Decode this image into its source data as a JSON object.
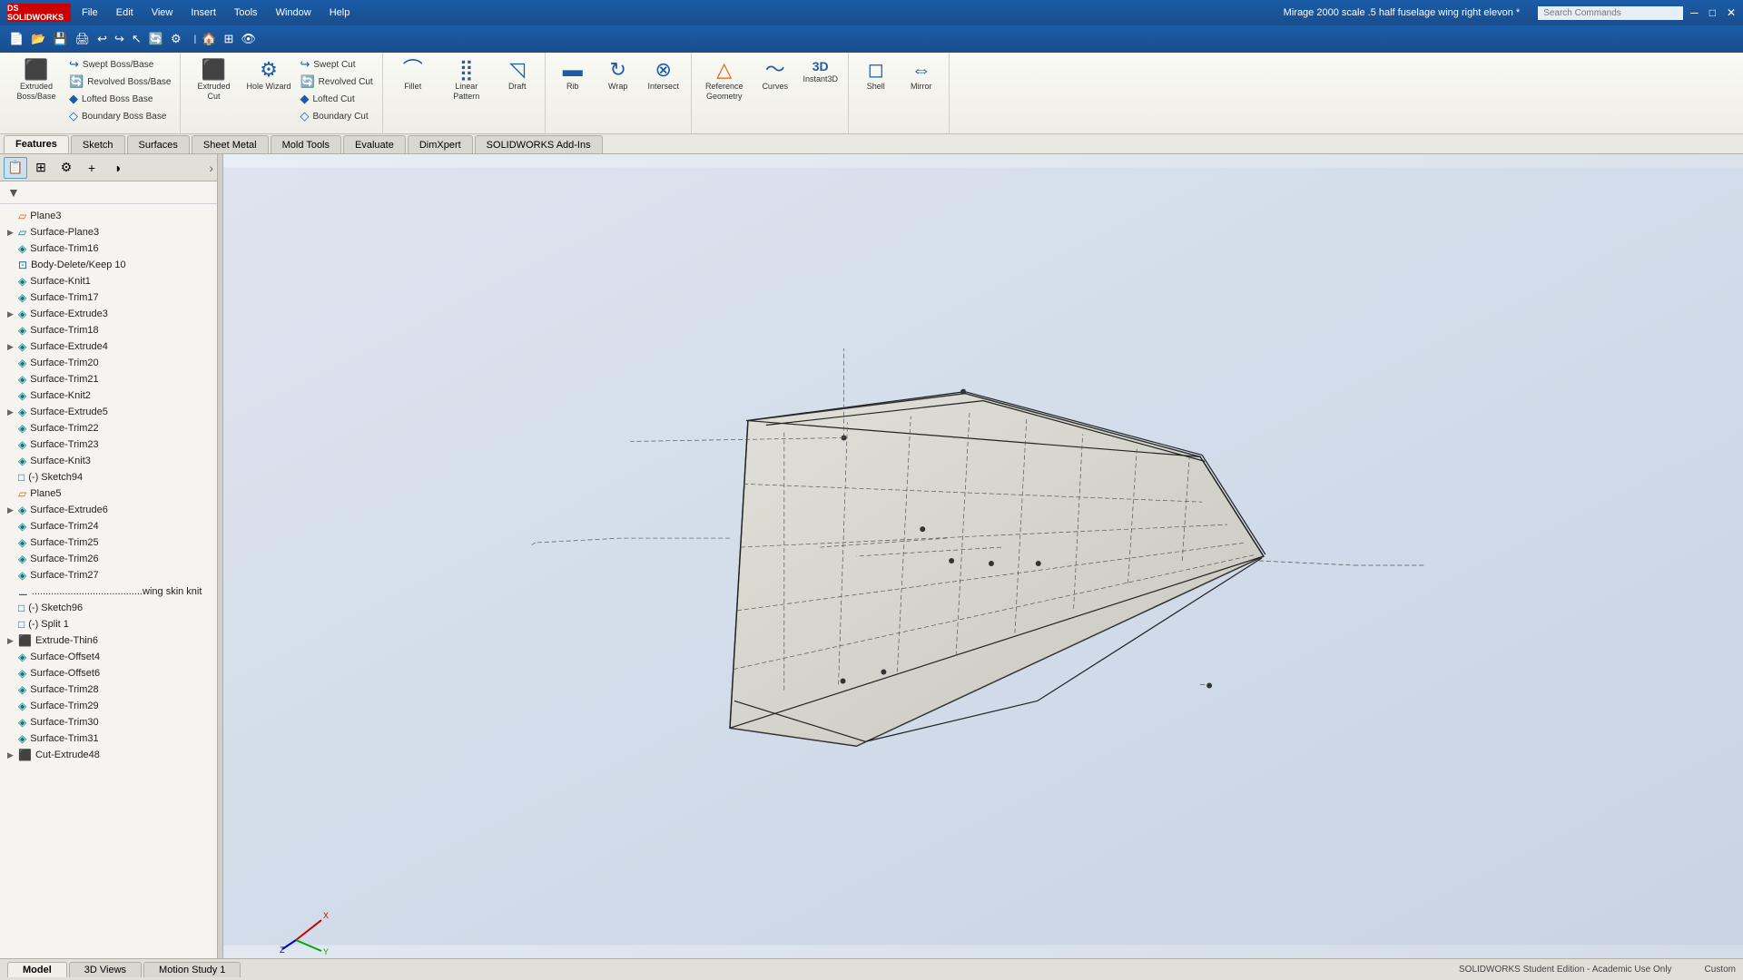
{
  "app": {
    "logo": "DS SOLIDWORKS",
    "name": "SOLIDWORKS",
    "doc_title": "Mirage 2000 scale .5 half fuselage wing right  elevon *"
  },
  "menu": {
    "items": [
      "File",
      "Edit",
      "View",
      "Insert",
      "Tools",
      "Window",
      "Help"
    ]
  },
  "search": {
    "placeholder": "Search Commands"
  },
  "ribbon": {
    "groups": [
      {
        "name": "boss-base-group",
        "items": [
          {
            "id": "extruded-boss",
            "label": "Extruded\nBoss/Base",
            "icon": "⬛"
          },
          {
            "id": "revolved-boss",
            "label": "Revolved\nBoss/Base",
            "icon": "🔄"
          },
          {
            "id": "lofted-boss",
            "label": "Lofted Boss\nBase",
            "icon": "◆"
          },
          {
            "id": "boundary-boss",
            "label": "Boundary Boss\nBase",
            "icon": "◇"
          }
        ],
        "subItems": [
          {
            "id": "swept-boss",
            "label": "Swept Boss/Base",
            "icon": "↪"
          }
        ]
      },
      {
        "name": "cut-group",
        "items": [
          {
            "id": "extruded-cut",
            "label": "Extruded\nCut",
            "icon": "⬛"
          },
          {
            "id": "hole-wizard",
            "label": "Hole\nWizard",
            "icon": "⚙"
          },
          {
            "id": "revolved-cut",
            "label": "Revolved\nCut",
            "icon": "🔄"
          }
        ],
        "subItems": [
          {
            "id": "swept-cut",
            "label": "Swept Cut",
            "icon": "↪"
          },
          {
            "id": "lofted-cut",
            "label": "Lofted Cut",
            "icon": "◆"
          },
          {
            "id": "boundary-cut",
            "label": "Boundary Cut",
            "icon": "◇"
          }
        ]
      },
      {
        "name": "features-group",
        "items": [
          {
            "id": "fillet",
            "label": "Fillet",
            "icon": "◜"
          },
          {
            "id": "linear-pattern",
            "label": "Linear\nPattern",
            "icon": "⣿"
          },
          {
            "id": "draft",
            "label": "Draft",
            "icon": "◹"
          }
        ]
      },
      {
        "name": "tools-group",
        "items": [
          {
            "id": "rib",
            "label": "Rib",
            "icon": "▬"
          },
          {
            "id": "wrap",
            "label": "Wrap",
            "icon": "↻"
          },
          {
            "id": "intersect",
            "label": "Intersect",
            "icon": "⊗"
          }
        ]
      },
      {
        "name": "reference-group",
        "items": [
          {
            "id": "reference-geometry",
            "label": "Reference\nGeometry",
            "icon": "△"
          },
          {
            "id": "curves",
            "label": "Curves",
            "icon": "〜"
          },
          {
            "id": "instant3d",
            "label": "Instant3D",
            "icon": "3D"
          }
        ]
      },
      {
        "name": "shell-mirror-group",
        "items": [
          {
            "id": "shell",
            "label": "Shell",
            "icon": "◻"
          },
          {
            "id": "mirror",
            "label": "Mirror",
            "icon": "⇔"
          }
        ]
      }
    ]
  },
  "tabs": {
    "feature_tabs": [
      "Features",
      "Sketch",
      "Surfaces",
      "Sheet Metal",
      "Mold Tools",
      "Evaluate",
      "DimXpert",
      "SOLIDWORKS Add-Ins"
    ],
    "active": "Features"
  },
  "panel": {
    "icons": [
      {
        "id": "feature-manager",
        "icon": "📋",
        "title": "FeatureManager"
      },
      {
        "id": "property-manager",
        "icon": "⊞",
        "title": "PropertyManager"
      },
      {
        "id": "configuration-manager",
        "icon": "⚙",
        "title": "ConfigurationManager"
      },
      {
        "id": "dim-xpert-manager",
        "icon": "+",
        "title": "DimXpertManager"
      },
      {
        "id": "display-manager",
        "icon": "◑",
        "title": "DisplayManager"
      }
    ],
    "expand-icon": "›"
  },
  "tree": {
    "items": [
      {
        "id": "plane3",
        "label": "Plane3",
        "icon": "▱",
        "indent": 0,
        "has_arrow": false,
        "icon_color": "orange"
      },
      {
        "id": "surface-plane3",
        "label": "Surface-Plane3",
        "icon": "▱",
        "indent": 0,
        "has_arrow": true,
        "icon_color": "teal"
      },
      {
        "id": "surface-trim16",
        "label": "Surface-Trim16",
        "icon": "◈",
        "indent": 0,
        "has_arrow": false,
        "icon_color": "teal"
      },
      {
        "id": "body-delete-keep10",
        "label": "Body-Delete/Keep 10",
        "icon": "⊡",
        "indent": 0,
        "has_arrow": false,
        "icon_color": "blue"
      },
      {
        "id": "surface-knit1",
        "label": "Surface-Knit1",
        "icon": "◈",
        "indent": 0,
        "has_arrow": false,
        "icon_color": "teal"
      },
      {
        "id": "surface-trim17",
        "label": "Surface-Trim17",
        "icon": "◈",
        "indent": 0,
        "has_arrow": false,
        "icon_color": "teal"
      },
      {
        "id": "surface-extrude3",
        "label": "Surface-Extrude3",
        "icon": "◈",
        "indent": 0,
        "has_arrow": true,
        "icon_color": "teal"
      },
      {
        "id": "surface-trim18",
        "label": "Surface-Trim18",
        "icon": "◈",
        "indent": 0,
        "has_arrow": false,
        "icon_color": "teal"
      },
      {
        "id": "surface-extrude4",
        "label": "Surface-Extrude4",
        "icon": "◈",
        "indent": 0,
        "has_arrow": true,
        "icon_color": "teal"
      },
      {
        "id": "surface-trim20",
        "label": "Surface-Trim20",
        "icon": "◈",
        "indent": 0,
        "has_arrow": false,
        "icon_color": "teal"
      },
      {
        "id": "surface-trim21",
        "label": "Surface-Trim21",
        "icon": "◈",
        "indent": 0,
        "has_arrow": false,
        "icon_color": "teal"
      },
      {
        "id": "surface-knit2",
        "label": "Surface-Knit2",
        "icon": "◈",
        "indent": 0,
        "has_arrow": false,
        "icon_color": "teal"
      },
      {
        "id": "surface-extrude5",
        "label": "Surface-Extrude5",
        "icon": "◈",
        "indent": 0,
        "has_arrow": true,
        "icon_color": "teal"
      },
      {
        "id": "surface-trim22",
        "label": "Surface-Trim22",
        "icon": "◈",
        "indent": 0,
        "has_arrow": false,
        "icon_color": "teal"
      },
      {
        "id": "surface-trim23",
        "label": "Surface-Trim23",
        "icon": "◈",
        "indent": 0,
        "has_arrow": false,
        "icon_color": "teal"
      },
      {
        "id": "surface-knit3",
        "label": "Surface-Knit3",
        "icon": "◈",
        "indent": 0,
        "has_arrow": false,
        "icon_color": "teal"
      },
      {
        "id": "sketch94",
        "label": "(-) Sketch94",
        "icon": "□",
        "indent": 0,
        "has_arrow": false,
        "icon_color": "blue"
      },
      {
        "id": "plane5",
        "label": "Plane5",
        "icon": "▱",
        "indent": 0,
        "has_arrow": false,
        "icon_color": "orange"
      },
      {
        "id": "surface-extrude6",
        "label": "Surface-Extrude6",
        "icon": "◈",
        "indent": 0,
        "has_arrow": true,
        "icon_color": "teal"
      },
      {
        "id": "surface-trim24",
        "label": "Surface-Trim24",
        "icon": "◈",
        "indent": 0,
        "has_arrow": false,
        "icon_color": "teal"
      },
      {
        "id": "surface-trim25",
        "label": "Surface-Trim25",
        "icon": "◈",
        "indent": 0,
        "has_arrow": false,
        "icon_color": "teal"
      },
      {
        "id": "surface-trim26",
        "label": "Surface-Trim26",
        "icon": "◈",
        "indent": 0,
        "has_arrow": false,
        "icon_color": "teal"
      },
      {
        "id": "surface-trim27",
        "label": "Surface-Trim27",
        "icon": "◈",
        "indent": 0,
        "has_arrow": false,
        "icon_color": "teal"
      },
      {
        "id": "wing-skin-knit",
        "label": "........................................wing skin knit",
        "icon": "⚊",
        "indent": 0,
        "has_arrow": false,
        "icon_color": "blue"
      },
      {
        "id": "sketch96",
        "label": "(-) Sketch96",
        "icon": "□",
        "indent": 0,
        "has_arrow": false,
        "icon_color": "blue"
      },
      {
        "id": "split1",
        "label": "(-) Split 1",
        "icon": "□",
        "indent": 0,
        "has_arrow": false,
        "icon_color": "blue"
      },
      {
        "id": "extrude-thin6",
        "label": "Extrude-Thin6",
        "icon": "⬛",
        "indent": 0,
        "has_arrow": true,
        "icon_color": "blue"
      },
      {
        "id": "surface-offset4",
        "label": "Surface-Offset4",
        "icon": "◈",
        "indent": 0,
        "has_arrow": false,
        "icon_color": "teal"
      },
      {
        "id": "surface-offset6",
        "label": "Surface-Offset6",
        "icon": "◈",
        "indent": 0,
        "has_arrow": false,
        "icon_color": "teal"
      },
      {
        "id": "surface-trim28",
        "label": "Surface-Trim28",
        "icon": "◈",
        "indent": 0,
        "has_arrow": false,
        "icon_color": "teal"
      },
      {
        "id": "surface-trim29",
        "label": "Surface-Trim29",
        "icon": "◈",
        "indent": 0,
        "has_arrow": false,
        "icon_color": "teal"
      },
      {
        "id": "surface-trim30",
        "label": "Surface-Trim30",
        "icon": "◈",
        "indent": 0,
        "has_arrow": false,
        "icon_color": "teal"
      },
      {
        "id": "surface-trim31",
        "label": "Surface-Trim31",
        "icon": "◈",
        "indent": 0,
        "has_arrow": false,
        "icon_color": "teal"
      },
      {
        "id": "cut-extrude48",
        "label": "Cut-Extrude48",
        "icon": "⬛",
        "indent": 0,
        "has_arrow": true,
        "icon_color": "blue"
      }
    ]
  },
  "bottom_tabs": [
    "Model",
    "3D Views",
    "Motion Study 1"
  ],
  "bottom_active_tab": "Model",
  "status": {
    "edition": "SOLIDWORKS Student Edition - Academic Use Only",
    "zoom": "Custom"
  },
  "viewport": {
    "has_model": true,
    "axis_colors": {
      "x": "#cc0000",
      "y": "#00aa00",
      "z": "#0000cc"
    }
  }
}
